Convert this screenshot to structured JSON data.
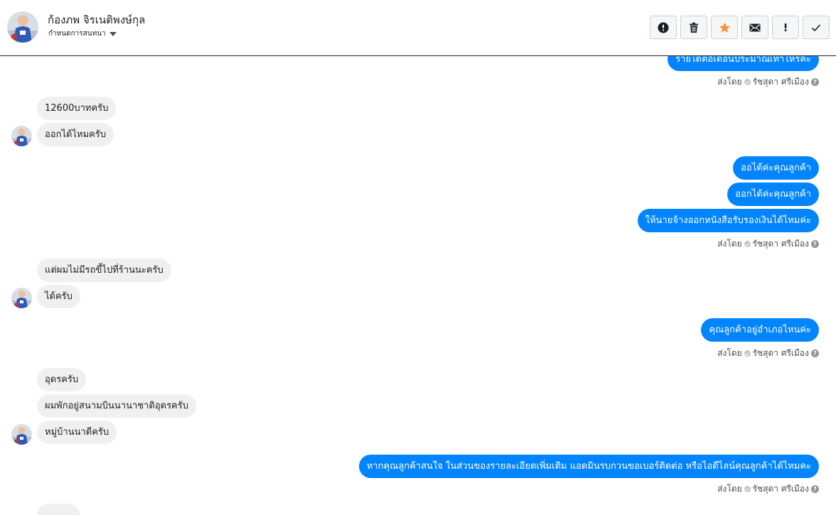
{
  "header": {
    "name": "ก้องภพ จิรเนติพงษ์กุล",
    "sub": "กำหนดการสนทนา",
    "sub_icon": "caret-down-icon",
    "toolbar": [
      {
        "icon": "alert-circle-icon",
        "glyph": "!"
      },
      {
        "icon": "trash-icon",
        "glyph": ""
      },
      {
        "icon": "star-icon",
        "glyph": "★",
        "color": "#f7923b"
      },
      {
        "icon": "envelope-icon",
        "glyph": ""
      },
      {
        "icon": "exclamation-icon",
        "glyph": "!"
      },
      {
        "icon": "check-icon",
        "glyph": "✓"
      }
    ]
  },
  "messages": {
    "out_0": "รายได้ต่อเดือนประมาณเท่าไหร่คะ",
    "in_1": "12600บาทครับ",
    "in_2": "ออกได้ไหมครับ",
    "out_3": "ออได้ค่ะคุณลูกค้า",
    "out_4": "ออกได้ค่ะคุณลูกค้า",
    "out_5": "ให้นายจ้างออกหนังสือรับรองเงินได้ไหมค่ะ",
    "in_6": "แต่ผมไม่มีรถขี้ไปที่ร้านนะครับ",
    "in_7": "ได้ครับ",
    "out_8": "คุณลูกค้าอยู่อำเภอไหนค่ะ",
    "in_9": "อุดรครับ",
    "in_10": "ผมพักอยู่สนามบินนานาชาติอุดรครับ",
    "in_11": "หมู่บ้านนาดีครับ",
    "out_12": "หากคุณลูกค้าสนใจ ในส่วนของรายละเอียดเพิ่มเติม แอดมินรบกวนขอเบอร์ติดต่อ หรือไอดีไลน์คุณลูกค้าได้ไหมคะ"
  },
  "meta": {
    "sent_by": "ส่งโดย",
    "sender": "รัชสุดา ศรีเมือง"
  },
  "colors": {
    "outgoing": "#0084ff",
    "incoming": "#f1f0f0"
  }
}
